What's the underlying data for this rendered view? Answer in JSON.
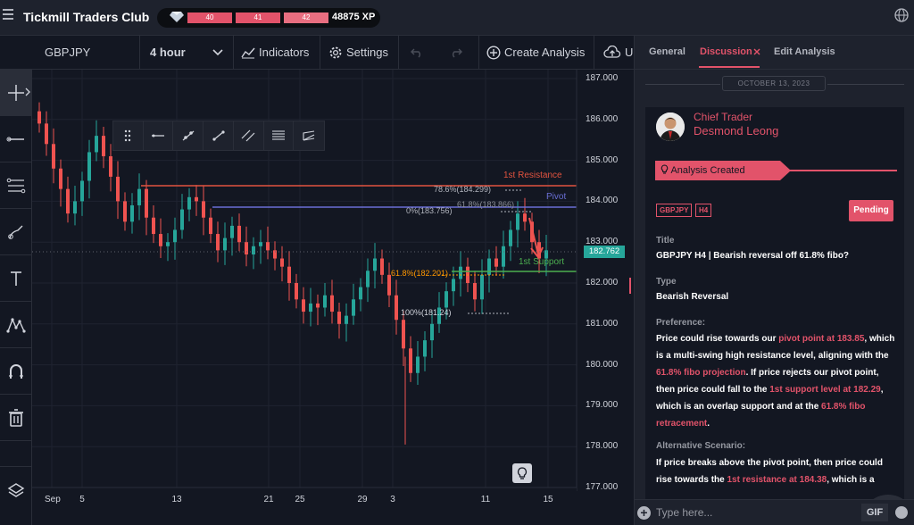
{
  "app": {
    "title": "Tickmill Traders Club"
  },
  "xp": {
    "levels": [
      "40",
      "41",
      "42"
    ],
    "value": "48875 XP"
  },
  "toolbar": {
    "symbol": "GBPJPY",
    "interval": "4 hour",
    "indicators_label": "Indicators",
    "settings_label": "Settings",
    "create_label": "Create Analysis",
    "upload_label": "U"
  },
  "chart": {
    "price_ticks": [
      "187.000",
      "186.000",
      "185.000",
      "184.000",
      "183.000",
      "182.000",
      "181.000",
      "180.000",
      "179.000",
      "178.000",
      "177.000"
    ],
    "date_ticks": [
      "Sep",
      "5",
      "13",
      "21",
      "25",
      "29",
      "3",
      "11",
      "15"
    ],
    "current_price": "182.762",
    "labels": {
      "resistance": "1st Resistance",
      "pivot": "Pivot",
      "support": "1st Support",
      "fib_786": "78.6%(184.299)",
      "fib_0": "0%(183.756)",
      "fib_618_top": "61.8%(183.866)",
      "fib_618_low": "61.8%(182.201)",
      "fib_100": "100%(181.24)"
    },
    "colors": {
      "resistance": "#e2533f",
      "pivot": "#6a6fd6",
      "support": "#4caf50",
      "arrow": "#ef5350",
      "fib": "#ff9800"
    },
    "chart_data": {
      "type": "candlestick",
      "series": [
        {
          "name": "GBPJPY",
          "values": [
            185.9,
            185.4,
            184.8,
            184.3,
            183.7,
            184.0,
            184.5,
            185.2,
            185.6,
            185.1,
            184.6,
            184.0,
            183.5,
            183.9,
            184.3,
            183.6,
            183.2,
            182.9,
            183.0,
            183.3,
            183.8,
            184.1,
            184.0,
            183.6,
            183.2,
            182.8,
            183.1,
            183.4,
            183.0,
            182.7,
            182.9,
            183.0,
            182.8,
            182.6,
            182.4,
            182.0,
            181.6,
            181.3,
            181.5,
            181.4,
            181.7,
            181.3,
            181.0,
            181.2,
            181.6,
            181.9,
            182.3,
            182.6,
            182.2,
            181.7,
            181.1,
            180.4,
            179.8,
            180.2,
            180.6,
            181.0,
            181.4,
            181.8,
            182.1,
            182.4,
            182.0,
            181.6,
            182.2,
            182.6,
            182.4,
            182.9,
            183.3,
            183.7,
            183.5,
            183.0,
            182.6,
            182.8
          ]
        }
      ],
      "ylim": [
        177.0,
        187.0
      ]
    }
  },
  "panel": {
    "tabs": [
      "General",
      "Discussion",
      "Edit Analysis"
    ],
    "date": "OCTOBER 13, 2023",
    "role": "Chief Trader",
    "author": "Desmond Leong",
    "status": "Analysis Created",
    "tags": [
      "GBPJPY",
      "H4"
    ],
    "pending_label": "Pending",
    "title_label": "Title",
    "title_value": "GBPJPY H4 | Bearish reversal off 61.8% fibo?",
    "type_label": "Type",
    "type_value": "Bearish Reversal",
    "preference_label": "Preference:",
    "preference_text": {
      "p1": "Price could rise towards our ",
      "p1_hl": "pivot point at 183.85",
      "p2": ", which is a multi-swing high resistance level, aligning with the ",
      "p2_hl": "61.8% fibo projection",
      "p3": ". If price rejects our pivot point, then price could fall to the ",
      "p3_hl": "1st support level at 182.29",
      "p4": ", which is an overlap support and at the ",
      "p4_hl": "61.8% fibo retracement",
      "p5": "."
    },
    "alt_label": "Alternative Scenario:",
    "alt_text": {
      "p1": "If price breaks above the pivot point, then price could rise towards the ",
      "p1_hl": "1st resistance at 184.38",
      "p2": ", which is a"
    },
    "composer_placeholder": "Type here...",
    "gif_label": "GIF"
  }
}
